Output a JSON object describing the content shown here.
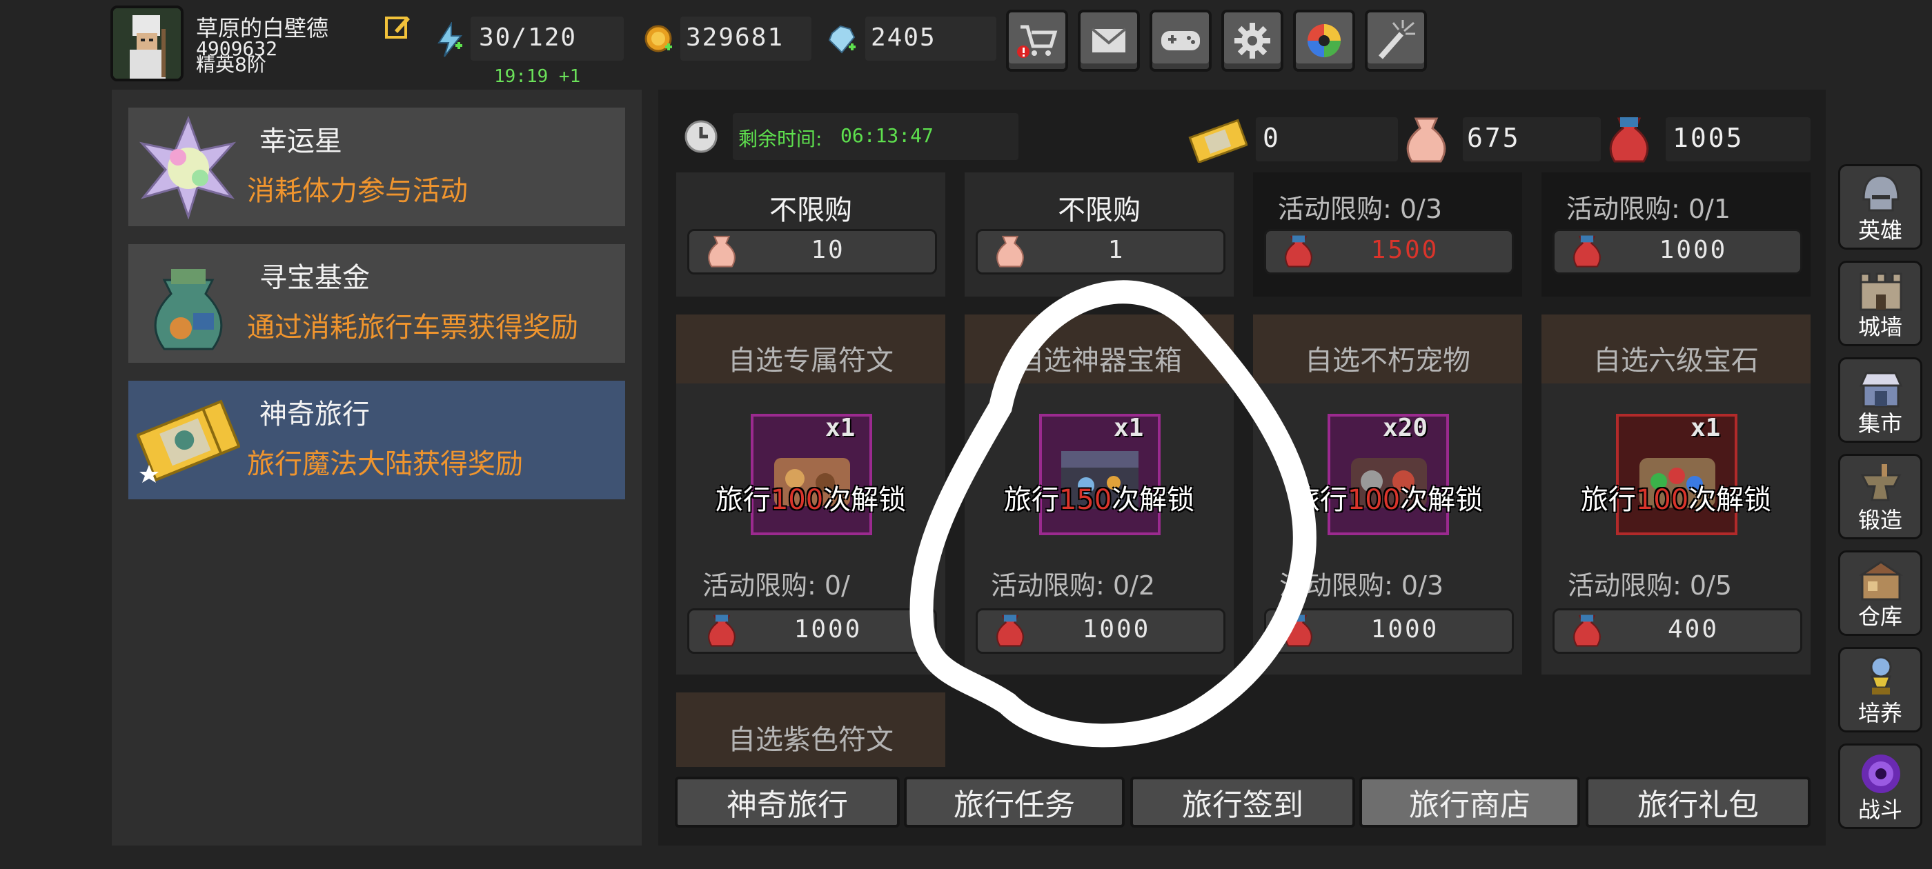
{
  "player": {
    "name": "草原的白壁德",
    "id": "4909632",
    "rank": "精英8阶"
  },
  "resources": {
    "stamina": "30/120",
    "stamina_timer": "19:19 +1",
    "gold": "329681",
    "gems": "2405"
  },
  "top_buttons": [
    "shop-cart-icon",
    "mail-icon",
    "gamepad-icon",
    "gear-icon",
    "color-wheel-icon",
    "firework-icon"
  ],
  "quests": [
    {
      "title": "幸运星",
      "desc": "消耗体力参与活动",
      "icon": "lucky-star-icon"
    },
    {
      "title": "寻宝基金",
      "desc": "通过消耗旅行车票获得奖励",
      "icon": "treasure-bag-icon"
    },
    {
      "title": "神奇旅行",
      "desc": "旅行魔法大陆获得奖励",
      "icon": "travel-ticket-icon"
    }
  ],
  "shop": {
    "timer_label": "剩余时间:",
    "timer_value": "06:13:47",
    "currencies": {
      "ticket": "0",
      "pink_bag": "675",
      "red_bag": "1005"
    },
    "top_row": [
      {
        "limit": "不限购",
        "price": "10",
        "currency": "pink-bag",
        "price_color": "#e8e8e8"
      },
      {
        "limit": "不限购",
        "price": "1",
        "currency": "pink-bag",
        "price_color": "#e8e8e8"
      },
      {
        "limit": "活动限购:  0/3",
        "price": "1500",
        "currency": "red-bag",
        "price_color": "#d9342b"
      },
      {
        "limit": "活动限购:  0/1",
        "price": "1000",
        "currency": "red-bag",
        "price_color": "#e8e8e8"
      }
    ],
    "cards": [
      {
        "title": "自选专属符文",
        "qty": "x1",
        "unlock_pre": "旅行",
        "unlock_num": "100",
        "unlock_post": "次解锁",
        "limit": "活动限购:  0/",
        "price": "1000",
        "frame": "#9b2a8f"
      },
      {
        "title": "自选神器宝箱",
        "qty": "x1",
        "unlock_pre": "旅行",
        "unlock_num": "150",
        "unlock_post": "次解锁",
        "limit": "活动限购:  0/2",
        "price": "1000",
        "frame": "#9b2a8f"
      },
      {
        "title": "自选不朽宠物",
        "qty": "x20",
        "unlock_pre": "旅行",
        "unlock_num": "100",
        "unlock_post": "次解锁",
        "limit": "活动限购:  0/3",
        "price": "1000",
        "frame": "#9b2a8f"
      },
      {
        "title": "自选六级宝石",
        "qty": "x1",
        "unlock_pre": "旅行",
        "unlock_num": "100",
        "unlock_post": "次解锁",
        "limit": "活动限购:  0/5",
        "price": "400",
        "frame": "#b22a2a"
      }
    ],
    "next_card_title": "自选紫色符文"
  },
  "tabs": [
    {
      "label": "神奇旅行",
      "active": false
    },
    {
      "label": "旅行任务",
      "active": false
    },
    {
      "label": "旅行签到",
      "active": false
    },
    {
      "label": "旅行商店",
      "active": true
    },
    {
      "label": "旅行礼包",
      "active": false
    }
  ],
  "side_nav": [
    {
      "label": "英雄",
      "icon": "helmet-icon"
    },
    {
      "label": "城墙",
      "icon": "castle-wall-icon"
    },
    {
      "label": "集市",
      "icon": "market-icon"
    },
    {
      "label": "锻造",
      "icon": "anvil-icon"
    },
    {
      "label": "仓库",
      "icon": "warehouse-icon"
    },
    {
      "label": "培养",
      "icon": "trophy-icon"
    },
    {
      "label": "战斗",
      "icon": "portal-icon"
    }
  ],
  "colors": {
    "accent_orange": "#f0952e",
    "timer_green": "#5ee04e",
    "active_tab": "#6e6e6e",
    "active_quest": "#3f5373",
    "red_price": "#d9342b"
  }
}
